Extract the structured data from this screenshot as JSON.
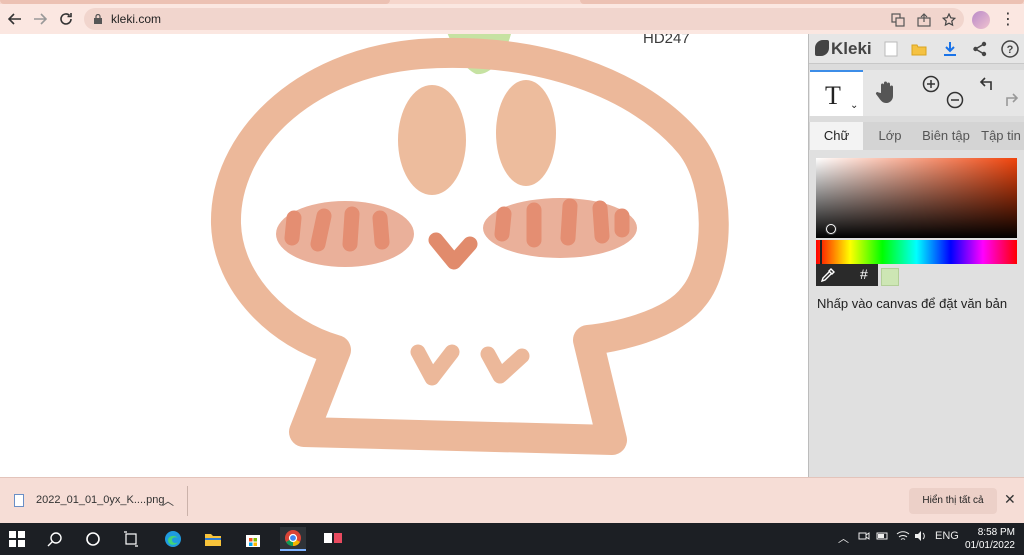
{
  "browser": {
    "url": "kleki.com"
  },
  "canvas": {
    "watermark": "HD247"
  },
  "kleki": {
    "brand": "Kleki",
    "tool_label": "T",
    "tabs": [
      "Chữ",
      "Lớp",
      "Biên tập",
      "Tập tin"
    ],
    "active_tab": "Chữ",
    "hex_label": "#",
    "hint": "Nhấp vào canvas để đặt văn bản",
    "swatch_color": "#cde6b4",
    "brush_color": "#eab89a"
  },
  "downloads": {
    "filename": "2022_01_01_0yx_K....png",
    "show_all": "Hiển thị tất cả"
  },
  "taskbar": {
    "language": "ENG",
    "time": "8:58 PM",
    "date": "01/01/2022"
  }
}
